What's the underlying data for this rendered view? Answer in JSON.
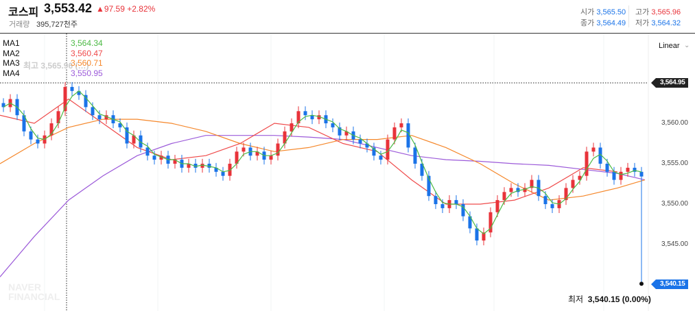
{
  "header": {
    "name": "코스피",
    "price": "3,553.42",
    "change": "▲97.59",
    "change_pct": "+2.82%",
    "volume_label": "거래량",
    "volume_value": "395,727천주",
    "open_label": "시가",
    "open": "3,565.50",
    "high_label": "고가",
    "high": "3,565.96",
    "close_label": "종가",
    "close": "3,564.49",
    "low_label": "저가",
    "low": "3,564.32"
  },
  "legend": [
    {
      "label": "MA1",
      "value": "3,564.34",
      "color": "#4cb944"
    },
    {
      "label": "MA2",
      "value": "3,560.47",
      "color": "#ef4a4a"
    },
    {
      "label": "MA3",
      "value": "3,560.71",
      "color": "#f5872a"
    },
    {
      "label": "MA4",
      "value": "3,550.95",
      "color": "#9b59d9"
    }
  ],
  "ghost_high": "최고 3,565.96 (…)",
  "scale_mode": "Linear",
  "crosshair_price": "3,564.95",
  "low_tag": "3,540.15",
  "low_label_prefix": "최저",
  "low_label_value": "3,540.15 (0.00%)",
  "watermark": "NAVER FINANCIAL",
  "colors": {
    "up": "#e8333a",
    "down": "#1a73e8"
  },
  "chart_data": {
    "type": "candlestick",
    "y_ticks": [
      "3,560.00",
      "3,555.00",
      "3,550.00",
      "3,545.00"
    ],
    "y_tick_values": [
      3560,
      3555,
      3550,
      3545
    ],
    "ylim": [
      3539,
      3566
    ],
    "closes": [
      3562,
      3563,
      3561,
      3559,
      3558,
      3557.5,
      3558.5,
      3560,
      3561.5,
      3564.5,
      3564,
      3563.5,
      3562,
      3561,
      3560.5,
      3561,
      3560,
      3559.5,
      3557.5,
      3558.5,
      3557,
      3556,
      3555.5,
      3556,
      3555,
      3555.5,
      3554.5,
      3555,
      3554.5,
      3555,
      3554.5,
      3554,
      3553.5,
      3555,
      3556.5,
      3557,
      3556,
      3556.5,
      3555.5,
      3556,
      3557.5,
      3559,
      3560,
      3561.5,
      3561,
      3560.5,
      3561,
      3560,
      3559.5,
      3558.5,
      3559,
      3558,
      3557.5,
      3557,
      3556,
      3555.5,
      3558,
      3559.5,
      3560,
      3557,
      3555,
      3553.5,
      3551,
      3550,
      3549.5,
      3550.5,
      3550,
      3548.5,
      3547,
      3545.5,
      3546.5,
      3549,
      3550.5,
      3551.5,
      3552,
      3551.5,
      3552,
      3553,
      3551,
      3550,
      3549.5,
      3550.5,
      3552,
      3553,
      3553.5,
      3556.5,
      3557,
      3555,
      3554,
      3553,
      3554,
      3554.5,
      3554,
      3553.42
    ],
    "last_low": 3540.15,
    "ma2": [
      3561,
      3560,
      3563,
      3560,
      3557,
      3555.5,
      3556,
      3557.5,
      3560,
      3559.5,
      3557.5,
      3556.5,
      3553,
      3550,
      3550,
      3550.5,
      3552,
      3554.5,
      3554
    ],
    "ma3": [
      3555,
      3557.5,
      3559.5,
      3560.5,
      3560.5,
      3560,
      3559,
      3557.5,
      3556.5,
      3557,
      3558,
      3558,
      3558.5,
      3557,
      3555,
      3552.5,
      3550.5,
      3551,
      3552,
      3553
    ],
    "ma4": [
      3541,
      3546,
      3550.5,
      3553.5,
      3556,
      3557.5,
      3558.5,
      3558.5,
      3558.5,
      3558.3,
      3558,
      3557,
      3556,
      3555.5,
      3555.3,
      3555,
      3554.8,
      3554.3,
      3553.8,
      3553
    ]
  }
}
